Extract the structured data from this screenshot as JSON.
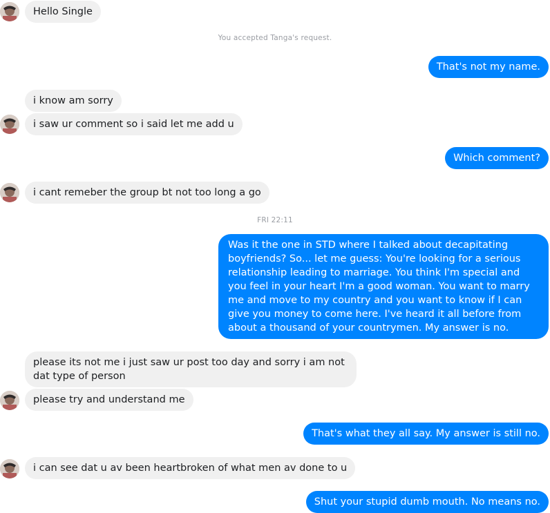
{
  "conversation": {
    "m1": "Hello Single",
    "system_note": "You accepted Tanga's request.",
    "m2": "That's not my name.",
    "m3": "i know am sorry",
    "m4": "i saw ur comment so i said let me add u",
    "m5": "Which comment?",
    "m6": "i cant remeber the group bt not too long a go",
    "timestamp": "FRI 22:11",
    "m7": "Was it the one in STD where I talked about decapitating boyfriends? So... let me guess: You're looking for a serious relationship leading to marriage. You think I'm special and you feel in your heart I'm a good woman. You want to marry me and move to my country and you want to know if I can give you money to come here. I've heard it all before from about a thousand of your countrymen. My answer is no.",
    "m8": "please its not me i just saw ur post too day and sorry i am not dat type of person",
    "m9": "please try and understand me",
    "m10": "That's what they all say. My answer is still no.",
    "m11": "i can see dat u av been heartbroken of what men av done to u",
    "m12": "Shut your stupid dumb mouth. No means no."
  },
  "colors": {
    "outgoing": "#0084ff",
    "incoming": "#f0f0f0",
    "meta": "#9a9da3"
  },
  "icons": {
    "avatar": "contact-avatar-icon"
  }
}
